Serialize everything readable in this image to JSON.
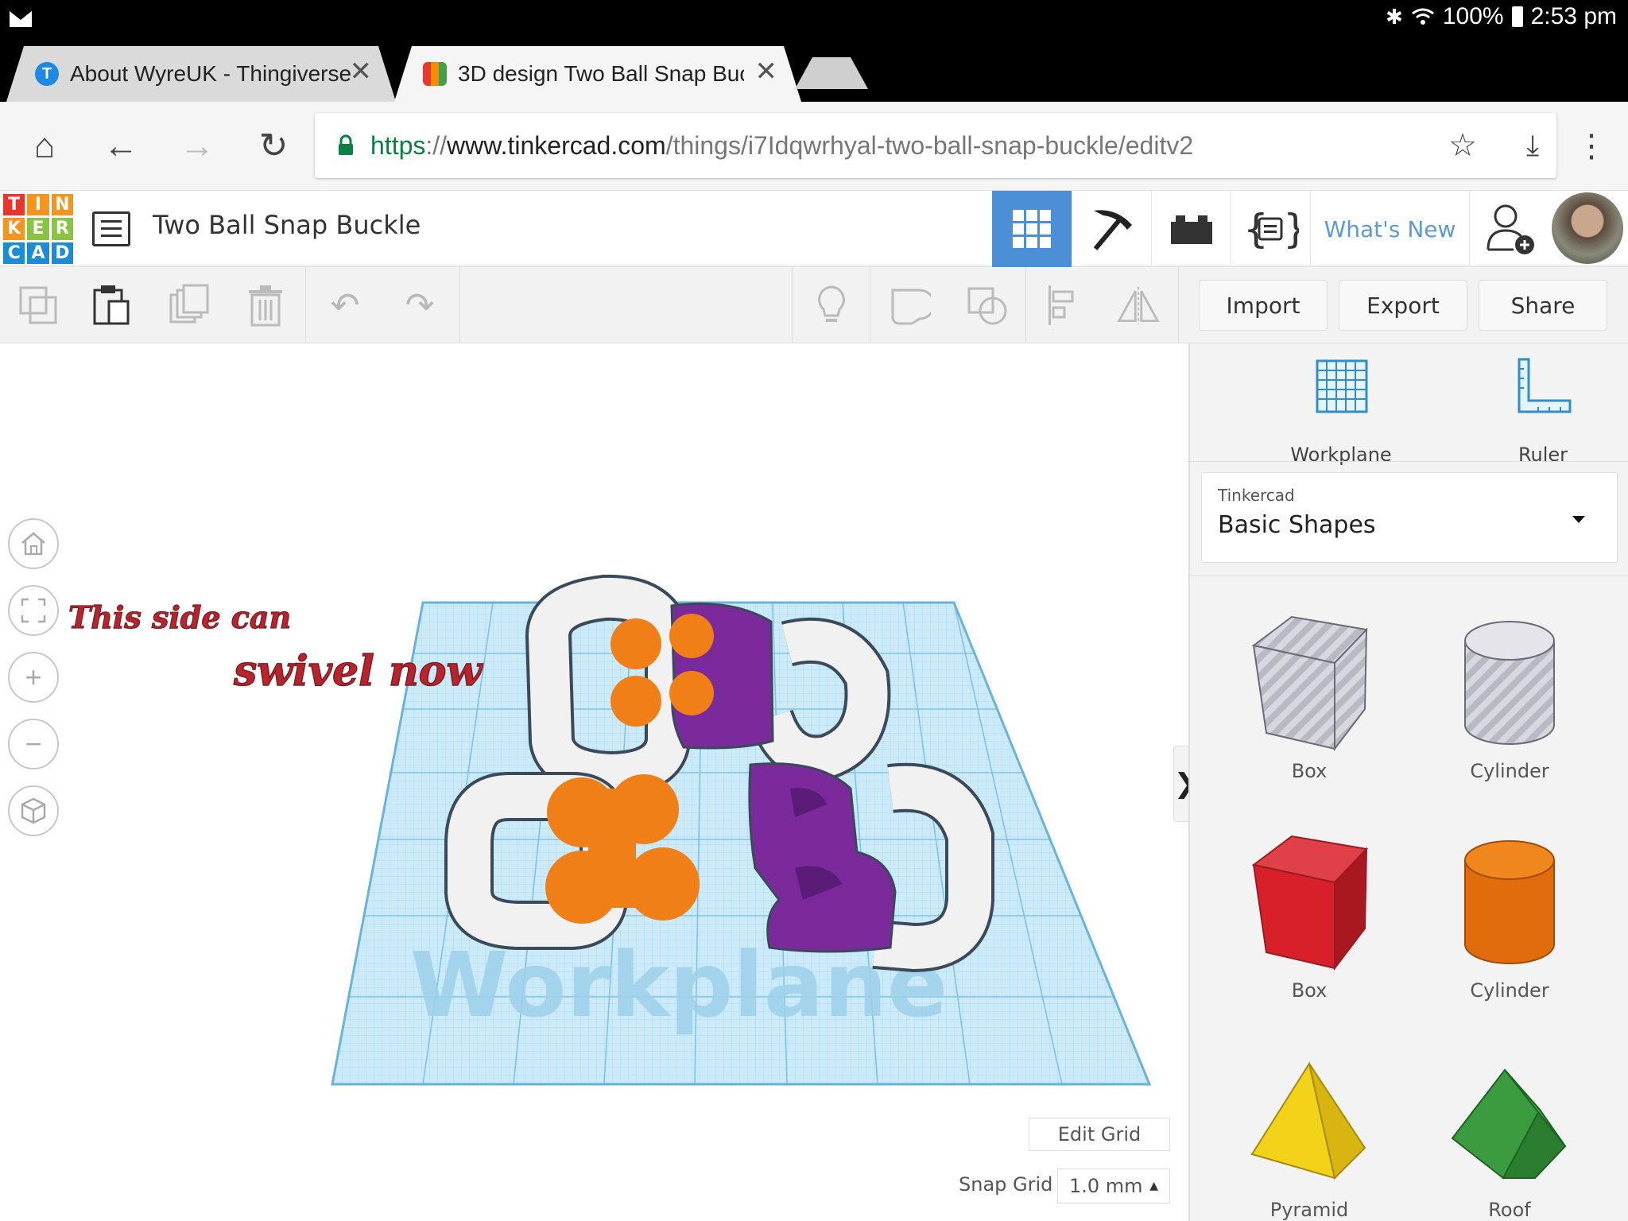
{
  "status_bar": {
    "battery": "100%",
    "time": "2:53 pm"
  },
  "tabs": [
    {
      "title": "About WyreUK - Thingiverse"
    },
    {
      "title": "3D design Two Ball Snap Buc"
    }
  ],
  "address_bar": {
    "url_scheme": "https",
    "url_sep": "://",
    "url_host": "www.tinkercad.com",
    "url_path": "/things/i7Idqwrhyal-two-ball-snap-buckle/editv2"
  },
  "app": {
    "logo_letters": [
      "T",
      "I",
      "N",
      "K",
      "E",
      "R",
      "C",
      "A",
      "D"
    ],
    "design_title": "Two Ball Snap Buckle",
    "whats_new": "What's New"
  },
  "toolbar": {
    "import_label": "Import",
    "export_label": "Export",
    "share_label": "Share"
  },
  "canvas": {
    "annotation_line1": "This side can",
    "annotation_line2": "swivel now",
    "workplane_label": "Workplane",
    "edit_grid_label": "Edit Grid",
    "snap_grid_label": "Snap Grid",
    "snap_grid_value": "1.0 mm"
  },
  "panel": {
    "workplane_label": "Workplane",
    "ruler_label": "Ruler",
    "library_category": "Tinkercad",
    "library_name": "Basic Shapes",
    "shapes": [
      {
        "label": "Box"
      },
      {
        "label": "Cylinder"
      },
      {
        "label": "Box"
      },
      {
        "label": "Cylinder"
      },
      {
        "label": "Pyramid"
      },
      {
        "label": "Roof"
      }
    ]
  }
}
